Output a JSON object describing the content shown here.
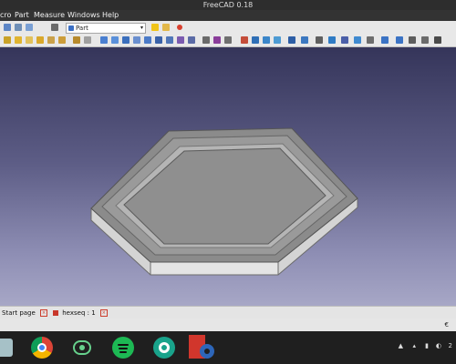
{
  "window": {
    "title": "FreeCAD 0.18"
  },
  "menu": {
    "items": [
      "cro",
      "Part",
      "Measure",
      "Windows",
      "Help"
    ]
  },
  "workbench": {
    "selected": "Part"
  },
  "tabs": [
    {
      "label": "Start page"
    },
    {
      "label": "hexseq : 1"
    }
  ],
  "status": {
    "right_text": "€"
  },
  "taskbar": {
    "apps": [
      "files-icon",
      "chrome-icon",
      "atom-icon",
      "spotify-icon",
      "camera-icon",
      "freecad-icon"
    ],
    "tray_time": "2"
  },
  "colors": {
    "viewport_top": "#35355a",
    "viewport_bottom": "#a7a7c6",
    "part_top": "#8a8a8a",
    "part_side": "#d8d8d8",
    "close_red": "#cc3d2c"
  }
}
